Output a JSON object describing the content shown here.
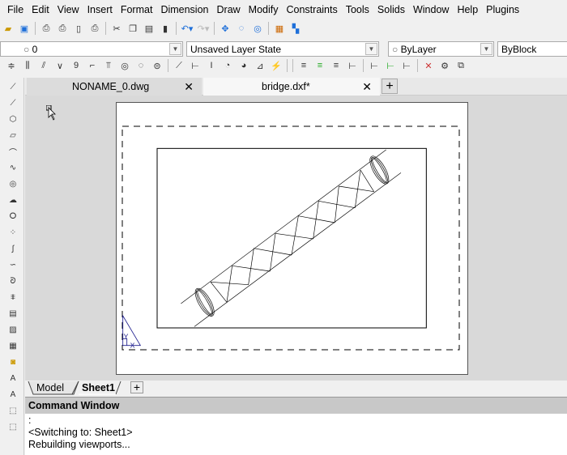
{
  "menu": [
    "File",
    "Edit",
    "View",
    "Insert",
    "Format",
    "Dimension",
    "Draw",
    "Modify",
    "Constraints",
    "Tools",
    "Solids",
    "Window",
    "Help",
    "Plugins"
  ],
  "layer": {
    "current": "0",
    "layer_state": "Unsaved Layer State",
    "color": "ByLayer",
    "linetype": "ByBlock"
  },
  "tabs": [
    {
      "label": "NONAME_0.dwg",
      "active": false
    },
    {
      "label": "bridge.dxf*",
      "active": true
    }
  ],
  "layout_tabs": [
    {
      "label": "Model",
      "active": false
    },
    {
      "label": "Sheet1",
      "active": true
    }
  ],
  "command_window": {
    "title": "Command Window",
    "lines": [
      ":",
      "<Switching to: Sheet1>",
      "Rebuilding viewports..."
    ]
  },
  "ucs": {
    "x": "X",
    "y": "Y"
  },
  "colors": {
    "ucs": "#1a1a8c",
    "accent": "#1e6fd9"
  }
}
